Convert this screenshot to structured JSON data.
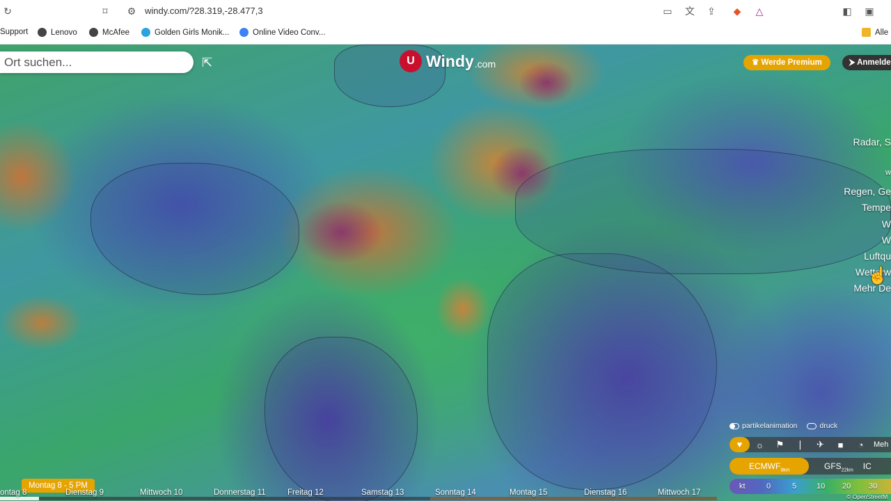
{
  "browser": {
    "url": "windy.com/?28.319,-28.477,3",
    "bookmarks": [
      "Support",
      "Lenovo",
      "McAfee",
      "Golden Girls Monik...",
      "Online Video Conv...",
      "Alle"
    ]
  },
  "app": {
    "logo_name": "Windy",
    "logo_tld": ".com",
    "search_placeholder": "Ort suchen...",
    "premium_label": "Werde Premium",
    "login_label": "Anmelden"
  },
  "menu": {
    "items": [
      "Radar, S",
      "w",
      "Regen, Ge",
      "Tempe",
      "W",
      "W",
      "Luftqu",
      "Wetterw",
      "Mehr De"
    ]
  },
  "toggles": {
    "particles_label": "partikelanimation",
    "pressure_label": "druck"
  },
  "layers": {
    "more_label": "Meh"
  },
  "models": [
    {
      "name": "ECMWF",
      "res": "9km",
      "active": true
    },
    {
      "name": "GFS",
      "res": "22km",
      "active": false
    },
    {
      "name": "IC",
      "res": "",
      "active": false
    }
  ],
  "scale": {
    "unit": "kt",
    "ticks": [
      "0",
      "5",
      "10",
      "20",
      "30"
    ]
  },
  "copyright": "© OpenStreetM",
  "timeline": {
    "current": "Montag 8 - 5 PM",
    "days": [
      "ontag 8",
      "Dienstag 9",
      "Mittwoch 10",
      "Donnerstag 11",
      "Freitag 12",
      "Samstag 13",
      "Sonntag 14",
      "Montag 15",
      "Dienstag 16",
      "Mittwoch 17"
    ]
  },
  "colors": {
    "accent": "#e6a400",
    "brand": "#c8102e"
  }
}
